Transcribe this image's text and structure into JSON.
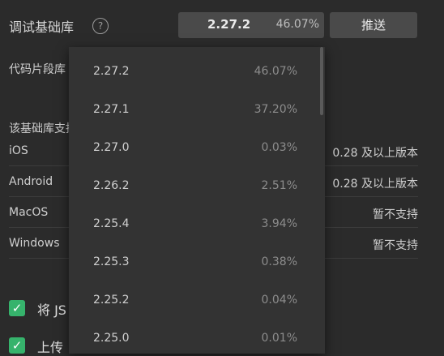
{
  "header": {
    "title": "调试基础库",
    "help_glyph": "?",
    "selected_version": "2.27.2",
    "selected_percent": "46.07%",
    "push_label": "推送"
  },
  "snippet_label": "代码片段库",
  "support_section": {
    "heading": "该基础库支持",
    "rows": [
      {
        "platform": "iOS",
        "status": "0.28 及以上版本"
      },
      {
        "platform": "Android",
        "status": "0.28 及以上版本"
      },
      {
        "platform": "MacOS",
        "status": "暂不支持"
      },
      {
        "platform": "Windows",
        "status": "暂不支持"
      }
    ]
  },
  "checkboxes": [
    {
      "label": "将 JS",
      "checked": true
    },
    {
      "label": "上传",
      "checked": true
    }
  ],
  "dropdown": {
    "items": [
      {
        "version": "2.27.2",
        "percent": "46.07%"
      },
      {
        "version": "2.27.1",
        "percent": "37.20%"
      },
      {
        "version": "2.27.0",
        "percent": "0.03%"
      },
      {
        "version": "2.26.2",
        "percent": "2.51%"
      },
      {
        "version": "2.25.4",
        "percent": "3.94%"
      },
      {
        "version": "2.25.3",
        "percent": "0.38%"
      },
      {
        "version": "2.25.2",
        "percent": "0.04%"
      },
      {
        "version": "2.25.0",
        "percent": "0.01%"
      }
    ]
  },
  "colors": {
    "background": "#2b2b2b",
    "dropdown": "#333333",
    "checkbox": "#36b36c",
    "control": "#4a4a4a"
  }
}
